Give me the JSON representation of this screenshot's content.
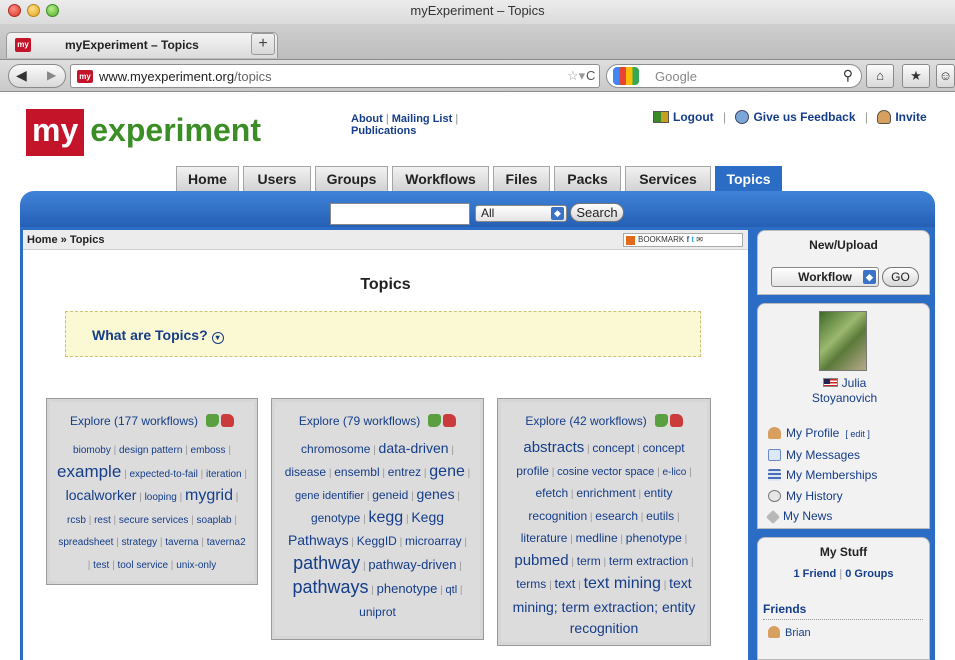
{
  "browser": {
    "window_title": "myExperiment – Topics",
    "tab_title": "myExperiment – Topics",
    "favicon_text": "my",
    "url_domain": "www.myexperiment.org",
    "url_path": "/topics",
    "search_placeholder": "Google"
  },
  "site": {
    "logo_my": "my",
    "logo_experiment": "experiment",
    "top_links": [
      "About",
      "Mailing List",
      "Publications"
    ],
    "user_links": [
      "Logout",
      "Give us Feedback",
      "Invite"
    ]
  },
  "nav": {
    "tabs": [
      "Home",
      "Users",
      "Groups",
      "Workflows",
      "Files",
      "Packs",
      "Services",
      "Topics"
    ],
    "active": "Topics"
  },
  "search": {
    "value": "",
    "select_value": "All",
    "button": "Search"
  },
  "breadcrumb": {
    "home": "Home",
    "sep": "»",
    "current": "Topics"
  },
  "bookmark": {
    "label": "BOOKMARK"
  },
  "page": {
    "title": "Topics",
    "what_are_topics": "What are Topics?"
  },
  "topics": [
    {
      "header": "Explore (177 workflows)",
      "tags": [
        {
          "t": "biomoby",
          "s": 10
        },
        {
          "t": "design pattern",
          "s": 10
        },
        {
          "t": "emboss",
          "s": 10
        },
        {
          "t": "example",
          "s": 17
        },
        {
          "t": "expected-to-fail",
          "s": 10
        },
        {
          "t": "iteration",
          "s": 10
        },
        {
          "t": "localworker",
          "s": 14
        },
        {
          "t": "looping",
          "s": 10
        },
        {
          "t": "mygrid",
          "s": 16
        },
        {
          "t": "rcsb",
          "s": 10
        },
        {
          "t": "rest",
          "s": 10
        },
        {
          "t": "secure services",
          "s": 10
        },
        {
          "t": "soaplab",
          "s": 10
        },
        {
          "t": "spreadsheet",
          "s": 10
        },
        {
          "t": "strategy",
          "s": 10
        },
        {
          "t": "taverna",
          "s": 10
        },
        {
          "t": "taverna2",
          "s": 10
        },
        {
          "t": "test",
          "s": 10
        },
        {
          "t": "tool service",
          "s": 10
        },
        {
          "t": "unix-only",
          "s": 10
        }
      ]
    },
    {
      "header": "Explore (79 workflows)",
      "tags": [
        {
          "t": "chromosome",
          "s": 12
        },
        {
          "t": "data-driven",
          "s": 14
        },
        {
          "t": "disease",
          "s": 12
        },
        {
          "t": "ensembl",
          "s": 12
        },
        {
          "t": "entrez",
          "s": 12
        },
        {
          "t": "gene",
          "s": 16
        },
        {
          "t": "gene identifier",
          "s": 11
        },
        {
          "t": "geneid",
          "s": 12
        },
        {
          "t": "genes",
          "s": 14
        },
        {
          "t": "genotype",
          "s": 12
        },
        {
          "t": "kegg",
          "s": 16
        },
        {
          "t": "Kegg Pathways",
          "s": 14
        },
        {
          "t": "KeggID",
          "s": 12
        },
        {
          "t": "microarray",
          "s": 12
        },
        {
          "t": "pathway",
          "s": 18
        },
        {
          "t": "pathway-driven",
          "s": 13
        },
        {
          "t": "pathways",
          "s": 18
        },
        {
          "t": "phenotype",
          "s": 13
        },
        {
          "t": "qtl",
          "s": 11
        },
        {
          "t": "uniprot",
          "s": 12
        }
      ]
    },
    {
      "header": "Explore (42 workflows)",
      "tags": [
        {
          "t": "abstracts",
          "s": 15
        },
        {
          "t": "concept",
          "s": 12
        },
        {
          "t": "concept profile",
          "s": 12
        },
        {
          "t": "cosine vector space",
          "s": 11
        },
        {
          "t": "e-lico",
          "s": 10
        },
        {
          "t": "efetch",
          "s": 12
        },
        {
          "t": "enrichment",
          "s": 12
        },
        {
          "t": "entity recognition",
          "s": 12
        },
        {
          "t": "esearch",
          "s": 12
        },
        {
          "t": "eutils",
          "s": 12
        },
        {
          "t": "literature",
          "s": 12
        },
        {
          "t": "medline",
          "s": 12
        },
        {
          "t": "phenotype",
          "s": 12
        },
        {
          "t": "pubmed",
          "s": 15
        },
        {
          "t": "term",
          "s": 12
        },
        {
          "t": "term extraction",
          "s": 12
        },
        {
          "t": "terms",
          "s": 12
        },
        {
          "t": "text",
          "s": 13
        },
        {
          "t": "text mining",
          "s": 16
        },
        {
          "t": "text mining; term extraction; entity recognition",
          "s": 14
        }
      ]
    }
  ],
  "sidebar": {
    "new_upload": {
      "title": "New/Upload",
      "select_value": "Workflow",
      "go": "GO"
    },
    "user": {
      "first_name": "Julia",
      "last_name": "Stoyanovich",
      "links": [
        "My Profile",
        "My Messages",
        "My Memberships",
        "My History",
        "My News"
      ],
      "edit": "[ edit ]"
    },
    "my_stuff": {
      "title": "My Stuff",
      "friends_count": "1 Friend",
      "groups_count": "0 Groups",
      "friends_heading": "Friends",
      "friends": [
        "Brian"
      ]
    }
  }
}
